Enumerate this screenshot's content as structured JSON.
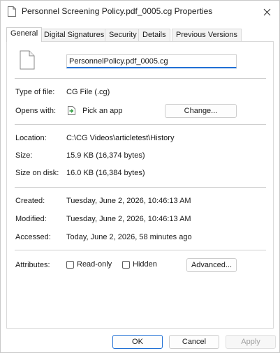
{
  "window": {
    "title": "Personnel Screening Policy.pdf_0005.cg Properties",
    "close_glyph": "✕"
  },
  "tabs": [
    {
      "label": "General",
      "active": true
    },
    {
      "label": "Digital Signatures",
      "active": false
    },
    {
      "label": "Security",
      "active": false
    },
    {
      "label": "Details",
      "active": false
    },
    {
      "label": "Previous Versions",
      "active": false
    }
  ],
  "general": {
    "file_name": "PersonnelPolicy.pdf_0005.cg",
    "type_label": "Type of file:",
    "type_value": "CG File (.cg)",
    "opens_label": "Opens with:",
    "opens_value": "Pick an app",
    "change_button": "Change...",
    "location_label": "Location:",
    "location_value": "C:\\CG Videos\\articletest\\History",
    "size_label": "Size:",
    "size_value": "15.9 KB (16,374 bytes)",
    "size_on_disk_label": "Size on disk:",
    "size_on_disk_value": "16.0 KB (16,384 bytes)",
    "created_label": "Created:",
    "created_value": "Tuesday, June 2, 2026, 10:46:13 AM",
    "modified_label": "Modified:",
    "modified_value": "Tuesday, June 2, 2026, 10:46:13 AM",
    "accessed_label": "Accessed:",
    "accessed_value": "Today, June 2, 2026, 58 minutes ago",
    "attributes_label": "Attributes:",
    "readonly_label": "Read-only",
    "readonly_checked": false,
    "hidden_label": "Hidden",
    "hidden_checked": false,
    "advanced_button": "Advanced..."
  },
  "footer": {
    "ok": "OK",
    "cancel": "Cancel",
    "apply": "Apply",
    "apply_enabled": false
  },
  "colors": {
    "accent": "#1f6fd4",
    "app_icon_green": "#2e9e3f"
  }
}
